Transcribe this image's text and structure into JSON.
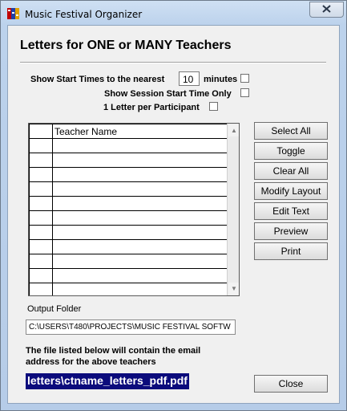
{
  "window": {
    "title": "Music Festival Organizer"
  },
  "heading": "Letters for ONE or MANY Teachers",
  "options": {
    "start_times_prefix": "Show Start Times to the nearest",
    "start_times_value": "10",
    "start_times_suffix": "minutes",
    "session_start_only": "Show Session Start Time Only",
    "one_letter_per_participant": "1 Letter per Participant"
  },
  "grid": {
    "columns": [
      "",
      "Teacher Name"
    ],
    "rows": [
      [
        "",
        ""
      ],
      [
        "",
        ""
      ],
      [
        "",
        ""
      ],
      [
        "",
        ""
      ],
      [
        "",
        ""
      ],
      [
        "",
        ""
      ],
      [
        "",
        ""
      ],
      [
        "",
        ""
      ],
      [
        "",
        ""
      ],
      [
        "",
        ""
      ],
      [
        "",
        ""
      ]
    ]
  },
  "buttons": {
    "select_all": "Select All",
    "toggle": "Toggle",
    "clear_all": "Clear All",
    "modify_layout": "Modify Layout",
    "edit_text": "Edit Text",
    "preview": "Preview",
    "print": "Print",
    "close": "Close"
  },
  "output": {
    "label": "Output Folder",
    "path": "C:\\USERS\\T480\\PROJECTS\\MUSIC FESTIVAL SOFTW"
  },
  "info_text": "The file listed below will contain the email address for the above teachers",
  "filename": "letters\\ctname_letters_pdf.pdf",
  "icons": {
    "app": "music-festival-app-icon",
    "close": "close-icon",
    "scroll_up": "scroll-up-arrow-icon",
    "scroll_down": "scroll-down-arrow-icon"
  }
}
